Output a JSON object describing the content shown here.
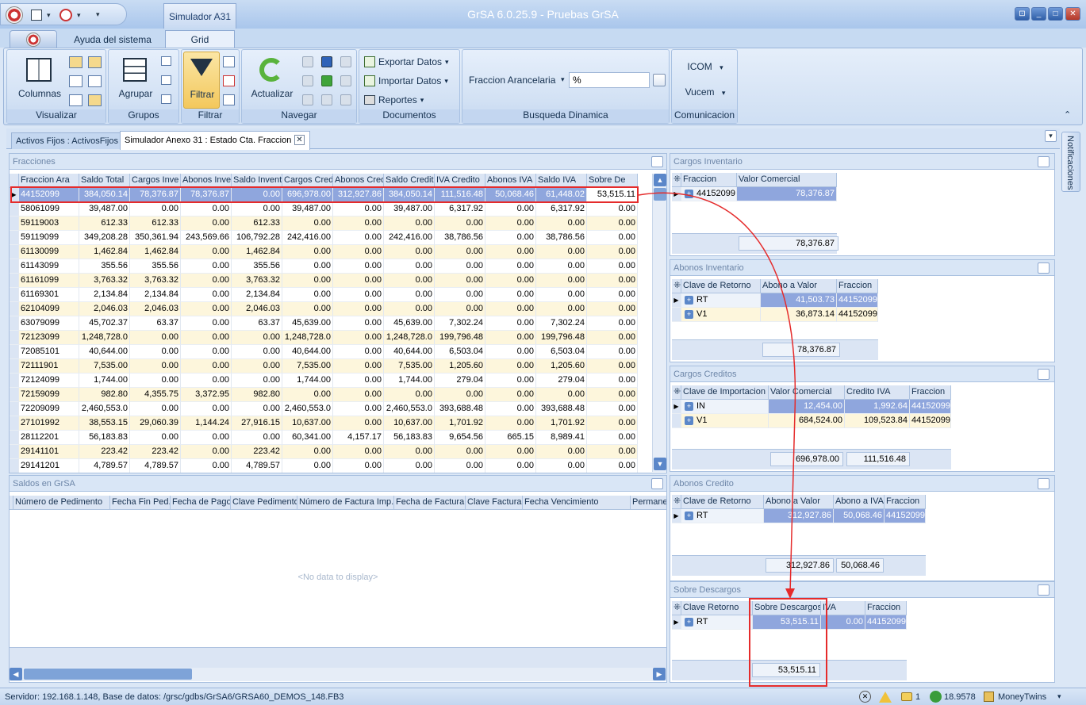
{
  "app_title": "GrSA 6.0.25.9 - Pruebas GrSA",
  "context_tab": "Simulador A31",
  "ribbon_tabs": [
    "Ayuda del sistema",
    "Grid"
  ],
  "groups": {
    "visualizar": {
      "label": "Visualizar",
      "main": "Columnas"
    },
    "grupos": {
      "label": "Grupos",
      "main": "Agrupar"
    },
    "filtrar": {
      "label": "Filtrar",
      "main": "Filtrar"
    },
    "navegar": {
      "label": "Navegar",
      "main": "Actualizar"
    },
    "documentos": {
      "label": "Documentos",
      "items": [
        "Exportar Datos",
        "Importar Datos",
        "Reportes"
      ]
    },
    "busqueda": {
      "label": "Busqueda Dinamica",
      "field_label": "Fraccion Arancelaria",
      "value": "%"
    },
    "comunicacion": {
      "label": "Comunicacion",
      "items": [
        "ICOM",
        "Vucem"
      ]
    }
  },
  "doc_tabs": [
    "Activos Fijos : ActivosFijos",
    "Simulador Anexo 31 : Estado Cta. Fraccion"
  ],
  "notificaciones": "Notificaciones",
  "fracciones": {
    "title": "Fracciones",
    "columns": [
      "Fraccion Ara",
      "Saldo Total",
      "Cargos Inve",
      "Abonos Inve",
      "Saldo Invent",
      "Cargos Cred",
      "Abonos Cred",
      "Saldo Credit",
      "IVA Credito",
      "Abonos IVA",
      "Saldo IVA",
      "Sobre De"
    ],
    "rows": [
      [
        "44152099",
        "384,050.14",
        "78,376.87",
        "78,376.87",
        "0.00",
        "696,978.00",
        "312,927.86",
        "384,050.14",
        "111,516.48",
        "50,068.46",
        "61,448.02",
        "53,515.11"
      ],
      [
        "58061099",
        "39,487.00",
        "0.00",
        "0.00",
        "0.00",
        "39,487.00",
        "0.00",
        "39,487.00",
        "6,317.92",
        "0.00",
        "6,317.92",
        "0.00"
      ],
      [
        "59119003",
        "612.33",
        "612.33",
        "0.00",
        "612.33",
        "0.00",
        "0.00",
        "0.00",
        "0.00",
        "0.00",
        "0.00",
        "0.00"
      ],
      [
        "59119099",
        "349,208.28",
        "350,361.94",
        "243,569.66",
        "106,792.28",
        "242,416.00",
        "0.00",
        "242,416.00",
        "38,786.56",
        "0.00",
        "38,786.56",
        "0.00"
      ],
      [
        "61130099",
        "1,462.84",
        "1,462.84",
        "0.00",
        "1,462.84",
        "0.00",
        "0.00",
        "0.00",
        "0.00",
        "0.00",
        "0.00",
        "0.00"
      ],
      [
        "61143099",
        "355.56",
        "355.56",
        "0.00",
        "355.56",
        "0.00",
        "0.00",
        "0.00",
        "0.00",
        "0.00",
        "0.00",
        "0.00"
      ],
      [
        "61161099",
        "3,763.32",
        "3,763.32",
        "0.00",
        "3,763.32",
        "0.00",
        "0.00",
        "0.00",
        "0.00",
        "0.00",
        "0.00",
        "0.00"
      ],
      [
        "61169301",
        "2,134.84",
        "2,134.84",
        "0.00",
        "2,134.84",
        "0.00",
        "0.00",
        "0.00",
        "0.00",
        "0.00",
        "0.00",
        "0.00"
      ],
      [
        "62104099",
        "2,046.03",
        "2,046.03",
        "0.00",
        "2,046.03",
        "0.00",
        "0.00",
        "0.00",
        "0.00",
        "0.00",
        "0.00",
        "0.00"
      ],
      [
        "63079099",
        "45,702.37",
        "63.37",
        "0.00",
        "63.37",
        "45,639.00",
        "0.00",
        "45,639.00",
        "7,302.24",
        "0.00",
        "7,302.24",
        "0.00"
      ],
      [
        "72123099",
        "1,248,728.0",
        "0.00",
        "0.00",
        "0.00",
        "1,248,728.0",
        "0.00",
        "1,248,728.0",
        "199,796.48",
        "0.00",
        "199,796.48",
        "0.00"
      ],
      [
        "72085101",
        "40,644.00",
        "0.00",
        "0.00",
        "0.00",
        "40,644.00",
        "0.00",
        "40,644.00",
        "6,503.04",
        "0.00",
        "6,503.04",
        "0.00"
      ],
      [
        "72111901",
        "7,535.00",
        "0.00",
        "0.00",
        "0.00",
        "7,535.00",
        "0.00",
        "7,535.00",
        "1,205.60",
        "0.00",
        "1,205.60",
        "0.00"
      ],
      [
        "72124099",
        "1,744.00",
        "0.00",
        "0.00",
        "0.00",
        "1,744.00",
        "0.00",
        "1,744.00",
        "279.04",
        "0.00",
        "279.04",
        "0.00"
      ],
      [
        "72159099",
        "982.80",
        "4,355.75",
        "3,372.95",
        "982.80",
        "0.00",
        "0.00",
        "0.00",
        "0.00",
        "0.00",
        "0.00",
        "0.00"
      ],
      [
        "72209099",
        "2,460,553.0",
        "0.00",
        "0.00",
        "0.00",
        "2,460,553.0",
        "0.00",
        "2,460,553.0",
        "393,688.48",
        "0.00",
        "393,688.48",
        "0.00"
      ],
      [
        "27101992",
        "38,553.15",
        "29,060.39",
        "1,144.24",
        "27,916.15",
        "10,637.00",
        "0.00",
        "10,637.00",
        "1,701.92",
        "0.00",
        "1,701.92",
        "0.00"
      ],
      [
        "28112201",
        "56,183.83",
        "0.00",
        "0.00",
        "0.00",
        "60,341.00",
        "4,157.17",
        "56,183.83",
        "9,654.56",
        "665.15",
        "8,989.41",
        "0.00"
      ],
      [
        "29141101",
        "223.42",
        "223.42",
        "0.00",
        "223.42",
        "0.00",
        "0.00",
        "0.00",
        "0.00",
        "0.00",
        "0.00",
        "0.00"
      ],
      [
        "29141201",
        "4,789.57",
        "4,789.57",
        "0.00",
        "4,789.57",
        "0.00",
        "0.00",
        "0.00",
        "0.00",
        "0.00",
        "0.00",
        "0.00"
      ]
    ]
  },
  "saldos": {
    "title": "Saldos en GrSA",
    "columns": [
      "Número de Pedimento",
      "Fecha Fin Ped.",
      "Fecha de Pago",
      "Clave Pedimento",
      "Número de Factura Imp.",
      "Fecha de Factura",
      "Clave Factura",
      "Fecha Vencimiento",
      "Permaner"
    ],
    "empty": "<No data to display>"
  },
  "cargos_inventario": {
    "title": "Cargos Inventario",
    "columns": [
      "Fraccion",
      "Valor Comercial"
    ],
    "rows": [
      [
        "44152099",
        "78,376.87"
      ]
    ],
    "totals": [
      "78,376.87"
    ]
  },
  "abonos_inventario": {
    "title": "Abonos Inventario",
    "columns": [
      "Clave de Retorno",
      "Abono a Valor",
      "Fraccion"
    ],
    "rows": [
      [
        "RT",
        "41,503.73",
        "44152099"
      ],
      [
        "V1",
        "36,873.14",
        "44152099"
      ]
    ],
    "totals": [
      "78,376.87"
    ]
  },
  "cargos_creditos": {
    "title": "Cargos Creditos",
    "columns": [
      "Clave de Importacion",
      "Valor Comercial",
      "Credito IVA",
      "Fraccion"
    ],
    "rows": [
      [
        "IN",
        "12,454.00",
        "1,992.64",
        "44152099"
      ],
      [
        "V1",
        "684,524.00",
        "109,523.84",
        "44152099"
      ]
    ],
    "totals": [
      "696,978.00",
      "111,516.48"
    ]
  },
  "abonos_credito": {
    "title": "Abonos Credito",
    "columns": [
      "Clave de Retorno",
      "Abono a Valor",
      "Abono a IVA",
      "Fraccion"
    ],
    "rows": [
      [
        "RT",
        "312,927.86",
        "50,068.46",
        "44152099"
      ]
    ],
    "totals": [
      "312,927.86",
      "50,068.46"
    ]
  },
  "sobre_descargos": {
    "title": "Sobre Descargos",
    "columns": [
      "Clave Retorno",
      "Sobre Descargos",
      "IVA",
      "Fraccion"
    ],
    "rows": [
      [
        "RT",
        "53,515.11",
        "0.00",
        "44152099"
      ]
    ],
    "totals": [
      "53,515.11"
    ]
  },
  "status": {
    "server": "Servidor: 192.168.1.148, Base de datos: /grsc/gdbs/GrSA6/GRSA60_DEMOS_148.FB3",
    "messages": "1",
    "rate": "18.9578",
    "company": "MoneyTwins"
  },
  "colors": {
    "accent": "#2e5b9a",
    "highlight": "#e52b2b",
    "selected": "#8fa6dd",
    "alt_row": "#fdf6dc"
  }
}
